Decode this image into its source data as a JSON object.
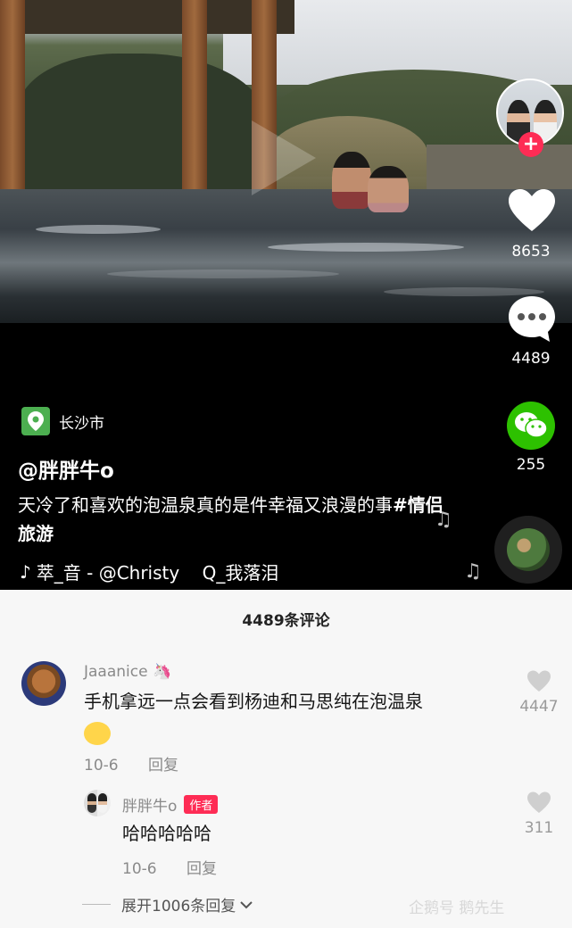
{
  "video": {
    "location": "长沙市",
    "author_handle": "@胖胖牛ο",
    "caption_text": "天冷了和喜欢的泡温泉真的是件幸福又浪漫的事",
    "caption_tag": "#情侣旅游",
    "music": "萃_音 - @Christy    Q_我落泪"
  },
  "rail": {
    "likes": "8653",
    "comments": "4489",
    "shares": "255",
    "follow_icon": "plus-icon"
  },
  "comments": {
    "title": "4489条评论",
    "items": [
      {
        "user": "Jaaanice",
        "text": "手机拿远一点会看到杨迪和马思纯在泡温泉",
        "date": "10-6",
        "reply_label": "回复",
        "likes": "4447"
      }
    ],
    "reply": {
      "user": "胖胖牛ο",
      "badge": "作者",
      "text": "哈哈哈哈哈",
      "date": "10-6",
      "reply_label": "回复",
      "likes": "311"
    },
    "expand_label": "展开1006条回复",
    "watermark": "企鹅号 鹅先生"
  },
  "colors": {
    "accent": "#fe2c55",
    "wechat": "#2dc100",
    "location": "#4caf50"
  }
}
